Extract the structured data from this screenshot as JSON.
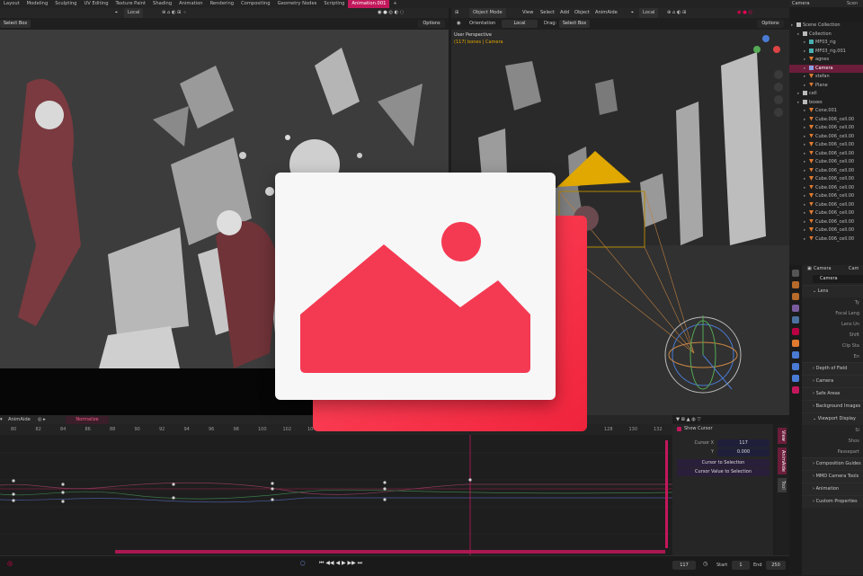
{
  "workspace_tabs": [
    "Layout",
    "Modeling",
    "Sculpting",
    "UV Editing",
    "Texture Paint",
    "Shading",
    "Animation",
    "Rendering",
    "Compositing",
    "Geometry Nodes",
    "Scripting",
    "Animation.001",
    "+"
  ],
  "active_tab_index": 11,
  "left_viewport": {
    "orientation_value": "Local",
    "select_box": "Select Box",
    "options": "Options"
  },
  "right_viewport": {
    "mode": "Object Mode",
    "menu": [
      "View",
      "Select",
      "Add",
      "Object",
      "AnimAide"
    ],
    "orientation_value": "Local",
    "tools_orientation_label": "Orientation",
    "tools_orientation_value": "Local",
    "drag_label": "Drag:",
    "select_box": "Select Box",
    "options": "Options",
    "overlay_title": "User Perspective",
    "overlay_sub": "(117) bones | Camera",
    "accent_color": "#e0a800"
  },
  "outliner": {
    "header": "Camera",
    "header2": "Scen",
    "rows": [
      {
        "label": "Scene Collection",
        "indent": 0,
        "icon": "collection",
        "selected": false
      },
      {
        "label": "Collection",
        "indent": 1,
        "icon": "collection",
        "selected": false
      },
      {
        "label": "MF03_rig",
        "indent": 2,
        "icon": "armature",
        "selected": false
      },
      {
        "label": "MF03_rig.001",
        "indent": 2,
        "icon": "armature",
        "selected": false
      },
      {
        "label": "agnes",
        "indent": 2,
        "icon": "mesh",
        "selected": false
      },
      {
        "label": "Camera",
        "indent": 2,
        "icon": "camera",
        "selected": true
      },
      {
        "label": "stefan",
        "indent": 2,
        "icon": "mesh",
        "selected": false
      },
      {
        "label": "Plane",
        "indent": 2,
        "icon": "mesh",
        "selected": false
      },
      {
        "label": "cell",
        "indent": 1,
        "icon": "collection",
        "selected": false
      },
      {
        "label": "boxes",
        "indent": 1,
        "icon": "collection",
        "selected": false
      },
      {
        "label": "Cone.001",
        "indent": 2,
        "icon": "mesh",
        "selected": false
      },
      {
        "label": "Cube.006_cell.00",
        "indent": 2,
        "icon": "mesh",
        "selected": false
      },
      {
        "label": "Cube.006_cell.00",
        "indent": 2,
        "icon": "mesh",
        "selected": false
      },
      {
        "label": "Cube.006_cell.00",
        "indent": 2,
        "icon": "mesh",
        "selected": false
      },
      {
        "label": "Cube.006_cell.00",
        "indent": 2,
        "icon": "mesh",
        "selected": false
      },
      {
        "label": "Cube.006_cell.00",
        "indent": 2,
        "icon": "mesh",
        "selected": false
      },
      {
        "label": "Cube.006_cell.00",
        "indent": 2,
        "icon": "mesh",
        "selected": false
      },
      {
        "label": "Cube.006_cell.00",
        "indent": 2,
        "icon": "mesh",
        "selected": false
      },
      {
        "label": "Cube.006_cell.00",
        "indent": 2,
        "icon": "mesh",
        "selected": false
      },
      {
        "label": "Cube.006_cell.00",
        "indent": 2,
        "icon": "mesh",
        "selected": false
      },
      {
        "label": "Cube.006_cell.00",
        "indent": 2,
        "icon": "mesh",
        "selected": false
      },
      {
        "label": "Cube.006_cell.00",
        "indent": 2,
        "icon": "mesh",
        "selected": false
      },
      {
        "label": "Cube.006_cell.00",
        "indent": 2,
        "icon": "mesh",
        "selected": false
      },
      {
        "label": "Cube.006_cell.00",
        "indent": 2,
        "icon": "mesh",
        "selected": false
      },
      {
        "label": "Cube.006_cell.00",
        "indent": 2,
        "icon": "mesh",
        "selected": false
      },
      {
        "label": "Cube.006_cell.00",
        "indent": 2,
        "icon": "mesh",
        "selected": false
      }
    ]
  },
  "properties": {
    "breadcrumb": "Camera",
    "breadcrumb2": "Cam",
    "datablock": "Camera",
    "panels": [
      {
        "label": "Lens",
        "open": true
      },
      {
        "label": "Depth of Field",
        "open": false
      },
      {
        "label": "Camera",
        "open": false
      },
      {
        "label": "Safe Areas",
        "open": false
      },
      {
        "label": "Background Images",
        "open": false
      },
      {
        "label": "Viewport Display",
        "open": true
      },
      {
        "label": "Composition Guides",
        "open": false
      },
      {
        "label": "MMD Camera Tools",
        "open": false
      },
      {
        "label": "Animation",
        "open": false
      },
      {
        "label": "Custom Properties",
        "open": false
      }
    ],
    "lens_fields": [
      "Ty",
      "Focal Leng",
      "Lens Un",
      "Shift",
      "Clip Sta",
      "En"
    ],
    "display_fields": [
      "Si",
      "Shov",
      "Passepart"
    ],
    "accent_color": "#c2185b"
  },
  "graph_editor": {
    "addon_label": "AnimAide",
    "normalize_label": "Normalize",
    "ruler_ticks": [
      "80",
      "82",
      "84",
      "86",
      "88",
      "90",
      "92",
      "94",
      "96",
      "98",
      "100",
      "102",
      "104",
      "",
      "",
      "",
      "",
      "",
      "",
      "",
      "",
      "",
      "",
      "",
      "128",
      "130",
      "132"
    ],
    "current_frame_marker": "117",
    "side_panel": {
      "show_cursor_label": "Show Cursor",
      "cursor_x_label": "Cursor X",
      "cursor_x_value": "117",
      "cursor_y_label": "Y",
      "cursor_y_value": "0.000",
      "btn_cursor_to_selection": "Cursor to Selection",
      "btn_cursor_value_to_selection": "Cursor Value to Selection"
    },
    "side_tabs": [
      "View",
      "AnimAide",
      "Tool"
    ]
  },
  "timeline": {
    "current_frame": "117",
    "start_label": "Start",
    "start_value": "1",
    "end_label": "End",
    "end_value": "250"
  },
  "colors": {
    "accent": "#c2185b",
    "placeholder_red": "#f43a52"
  }
}
